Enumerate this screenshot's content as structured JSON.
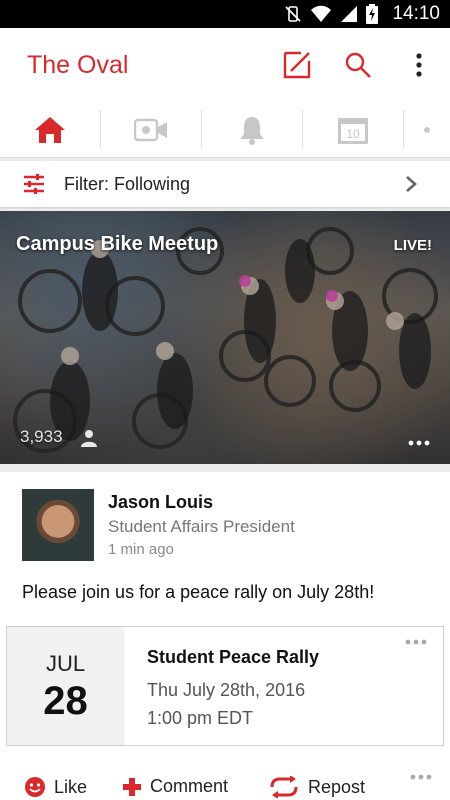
{
  "status_bar": {
    "time": "14:10",
    "icons": [
      "vibrate-off-icon",
      "wifi-icon",
      "signal-icon",
      "battery-charging-icon"
    ]
  },
  "app_bar": {
    "title": "The Oval",
    "actions": [
      "compose-icon",
      "search-icon",
      "more-vert-icon"
    ]
  },
  "tabs": {
    "items": [
      {
        "name": "home",
        "icon": "home-icon",
        "selected": true
      },
      {
        "name": "video",
        "icon": "video-icon",
        "selected": false
      },
      {
        "name": "notifications",
        "icon": "bell-icon",
        "selected": false
      },
      {
        "name": "calendar",
        "icon": "calendar-icon",
        "badge": "10",
        "selected": false
      },
      {
        "name": "more",
        "icon": "dot-icon",
        "selected": false
      }
    ]
  },
  "filter": {
    "label": "Filter: Following",
    "icon": "sliders-icon",
    "chevron": "chevron-right-icon"
  },
  "hero": {
    "title": "Campus Bike Meetup",
    "live_label": "LIVE!",
    "viewer_count": "3,933"
  },
  "post": {
    "author": "Jason Louis",
    "role": "Student Affairs President",
    "time": "1 min ago",
    "message": "Please join us for a peace rally on July 28th!",
    "event": {
      "month": "JUL",
      "day": "28",
      "title": "Student Peace Rally",
      "date_line": "Thu July 28th, 2016",
      "time_line": "1:00 pm EDT"
    },
    "actions": {
      "like": "Like",
      "comment": "Comment",
      "repost": "Repost"
    }
  },
  "colors": {
    "accent": "#d9292b",
    "inactive_icon": "#c7c7c7"
  }
}
